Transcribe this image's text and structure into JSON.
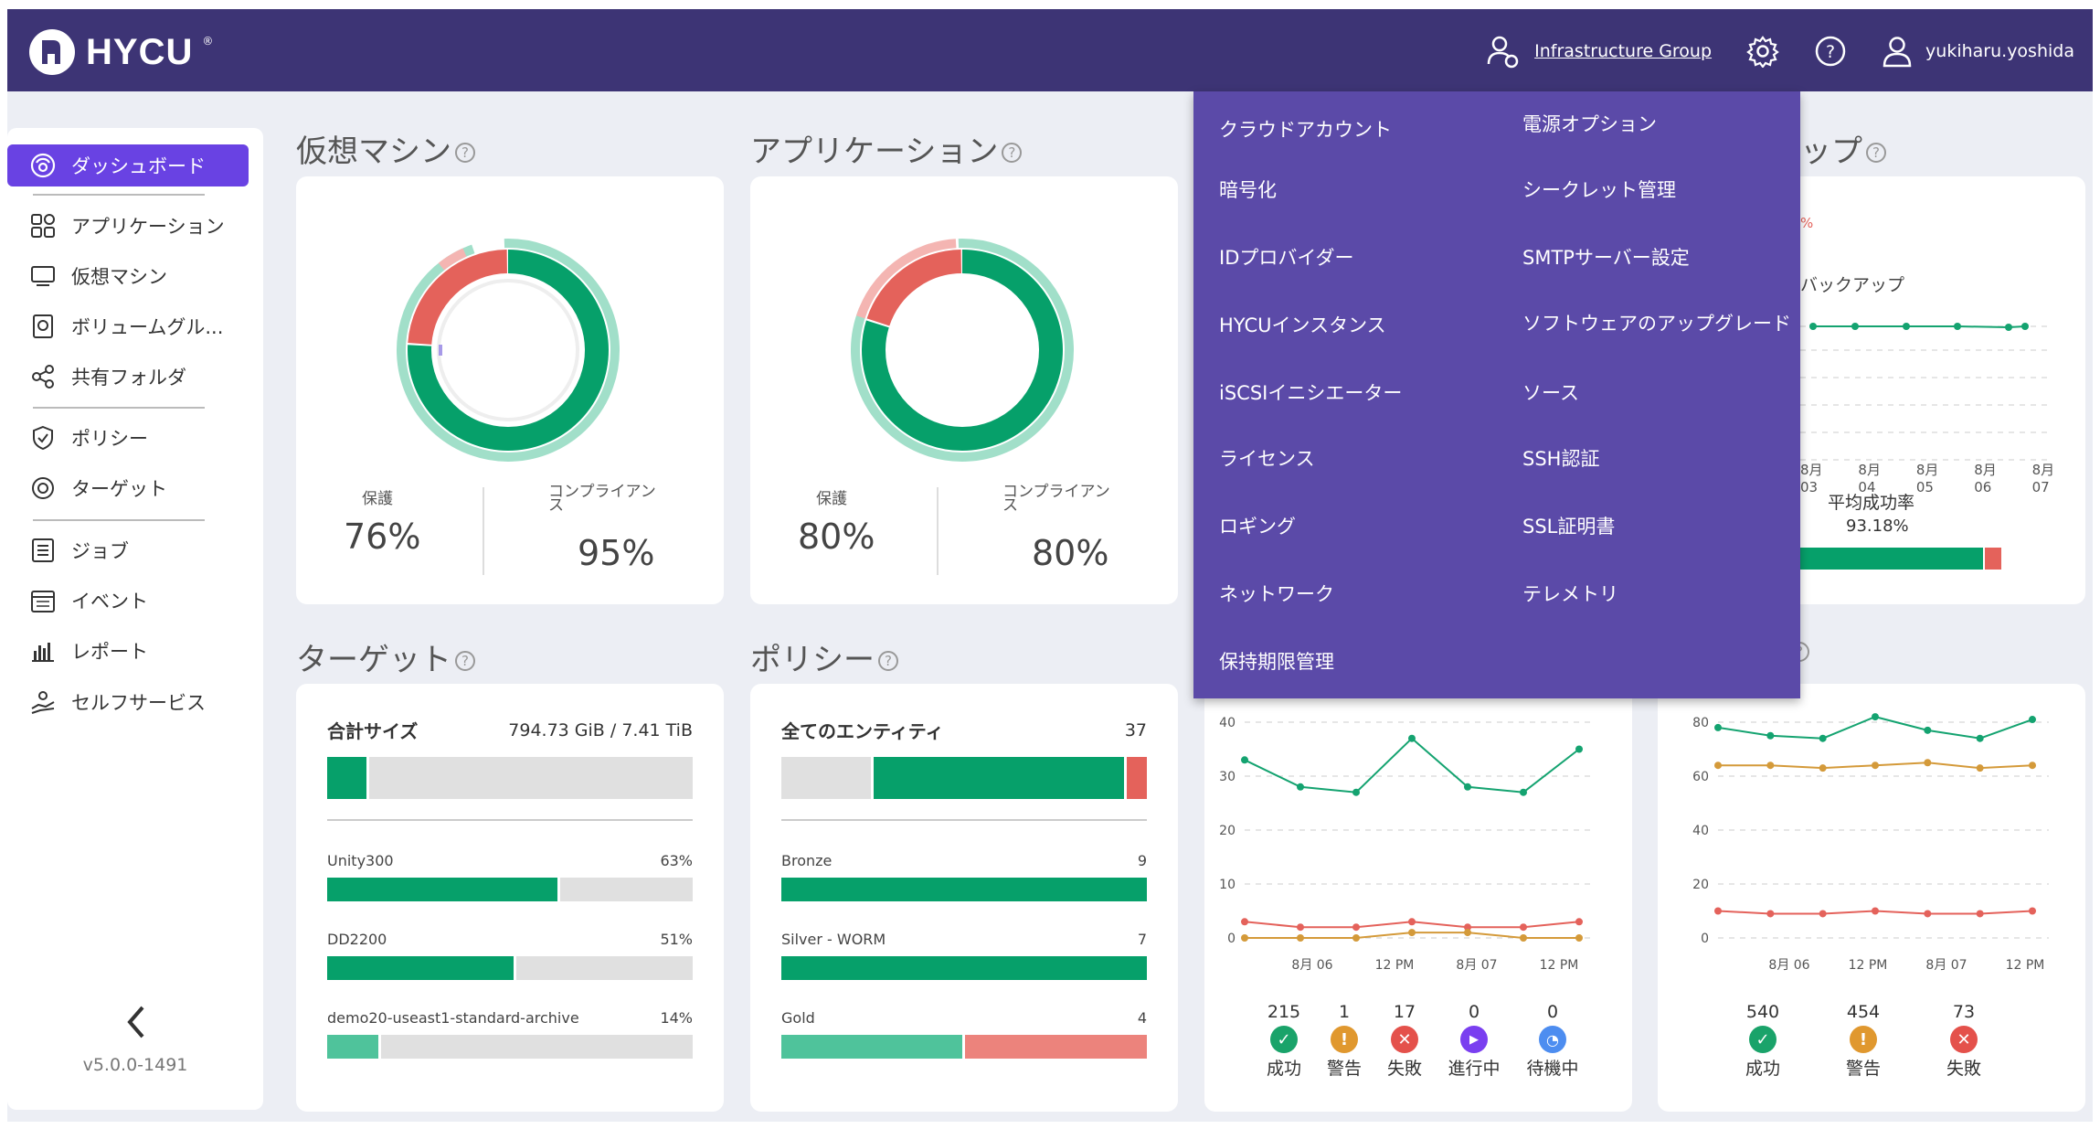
{
  "header": {
    "logo": "HYCU",
    "logo_mark": "®",
    "group_link": "Infrastructure Group",
    "username": "yukiharu.yoshida"
  },
  "sidebar": {
    "items": [
      {
        "label": "ダッシュボード",
        "icon": "dashboard-icon"
      },
      {
        "label": "アプリケーション",
        "icon": "applications-icon"
      },
      {
        "label": "仮想マシン",
        "icon": "monitor-icon"
      },
      {
        "label": "ボリュームグル...",
        "icon": "volume-icon"
      },
      {
        "label": "共有フォルダ",
        "icon": "share-icon"
      },
      {
        "label": "ポリシー",
        "icon": "shield-icon"
      },
      {
        "label": "ターゲット",
        "icon": "target-icon"
      },
      {
        "label": "ジョブ",
        "icon": "jobs-icon"
      },
      {
        "label": "イベント",
        "icon": "calendar-icon"
      },
      {
        "label": "レポート",
        "icon": "report-icon"
      },
      {
        "label": "セルフサービス",
        "icon": "self-service-icon"
      }
    ],
    "version": "v5.0.0-1491"
  },
  "vm_card": {
    "title": "仮想マシン",
    "protected_label": "保護",
    "protected_value": "76%",
    "compliance_label": "コンプライアン\nス",
    "compliance_value": "95%"
  },
  "app_card": {
    "title": "アプリケーション",
    "protected_label": "保護",
    "protected_value": "80%",
    "compliance_label": "コンプライアン\nス",
    "compliance_value": "80%"
  },
  "backup_card": {
    "title_partial": "ップ",
    "pct_partial": "%",
    "legend_partial": "バックアップ",
    "dates": [
      "8月 03",
      "8月 04",
      "8月 05",
      "8月 06",
      "8月 07"
    ],
    "avg_label": "平均成功率",
    "avg_value": "93.18%"
  },
  "target_card": {
    "title": "ターゲット",
    "total_label": "合計サイズ",
    "total_value": "794.73 GiB / 7.41 TiB",
    "rows": [
      {
        "name": "Unity300",
        "value": "63%"
      },
      {
        "name": "DD2200",
        "value": "51%"
      },
      {
        "name": "demo20-useast1-standard-archive",
        "value": "14%"
      }
    ]
  },
  "policy_card": {
    "title": "ポリシー",
    "total_label": "全てのエンティティ",
    "total_value": "37",
    "rows": [
      {
        "name": "Bronze",
        "value": "9"
      },
      {
        "name": "Silver - WORM",
        "value": "7"
      },
      {
        "name": "Gold",
        "value": "4"
      }
    ]
  },
  "jobs_card": {
    "stats": [
      {
        "num": "215",
        "label": "成功",
        "color": "#1aa36a",
        "glyph": "✓"
      },
      {
        "num": "1",
        "label": "警告",
        "color": "#e0982f",
        "glyph": "!"
      },
      {
        "num": "17",
        "label": "失敗",
        "color": "#e4514b",
        "glyph": "✕"
      },
      {
        "num": "0",
        "label": "進行中",
        "color": "#7a3ff0",
        "glyph": "▶"
      },
      {
        "num": "0",
        "label": "待機中",
        "color": "#4d8df0",
        "glyph": "◔"
      }
    ]
  },
  "events_card": {
    "title_partial": "?",
    "stats": [
      {
        "num": "540",
        "label": "成功",
        "color": "#1aa36a",
        "glyph": "✓"
      },
      {
        "num": "454",
        "label": "警告",
        "color": "#e0982f",
        "glyph": "!"
      },
      {
        "num": "73",
        "label": "失敗",
        "color": "#e4514b",
        "glyph": "✕"
      }
    ]
  },
  "chart_data": [
    {
      "type": "line",
      "x": [
        "",
        "8月 06",
        "",
        "12 PM",
        "",
        "8月 07",
        "",
        "12 PM"
      ],
      "ylim": [
        0,
        40
      ],
      "yticks": [
        0,
        10,
        20,
        30,
        40
      ],
      "xticks": [
        "8月 06",
        "12 PM",
        "8月 07",
        "12 PM"
      ],
      "series": [
        {
          "values": [
            33,
            28,
            27,
            37,
            28,
            27,
            35
          ],
          "color": "#14a370"
        },
        {
          "values": [
            3,
            2,
            2,
            3,
            2,
            2,
            3
          ],
          "color": "#e4625b"
        },
        {
          "values": [
            0,
            0,
            0,
            1,
            1,
            0,
            0
          ],
          "color": "#d49a3a"
        }
      ]
    },
    {
      "type": "line",
      "ylim": [
        0,
        80
      ],
      "yticks": [
        0,
        20,
        40,
        60,
        80
      ],
      "xticks": [
        "8月 06",
        "12 PM",
        "8月 07",
        "12 PM"
      ],
      "series": [
        {
          "values": [
            78,
            75,
            74,
            82,
            77,
            74,
            81
          ],
          "color": "#14a370"
        },
        {
          "values": [
            64,
            64,
            63,
            64,
            65,
            63,
            64
          ],
          "color": "#d49a3a"
        },
        {
          "values": [
            10,
            9,
            9,
            10,
            9,
            9,
            10
          ],
          "color": "#e4625b"
        }
      ]
    }
  ],
  "menu": {
    "left": [
      "クラウドアカウント",
      "暗号化",
      "IDプロバイダー",
      "HYCUインスタンス",
      "iSCSIイニシエーター",
      "ライセンス",
      "ロギング",
      "ネットワーク",
      "保持期限管理"
    ],
    "right": [
      "電源オプション",
      "シークレット管理",
      "SMTPサーバー設定",
      "ソフトウェアのアップグレード",
      "ソース",
      "SSH認証",
      "SSL証明書",
      "テレメトリ"
    ]
  }
}
